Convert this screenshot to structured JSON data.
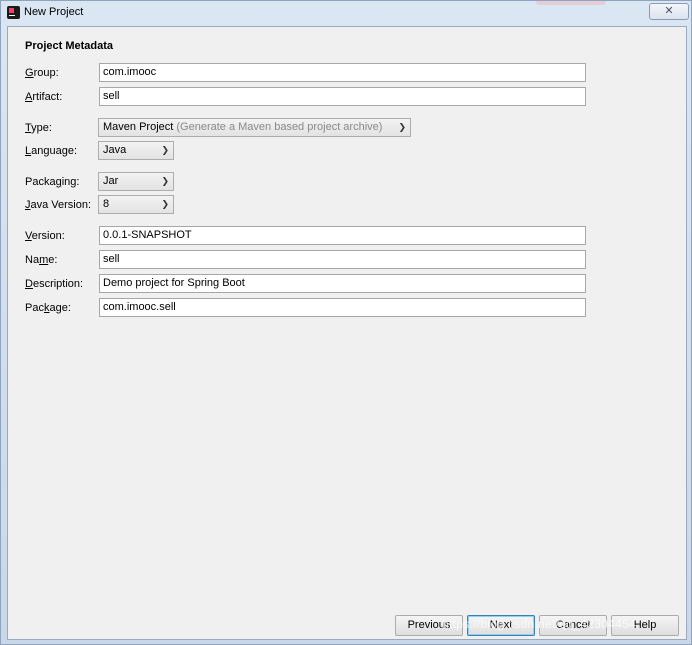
{
  "window": {
    "title": "New Project",
    "close_symbol": "✕"
  },
  "section": {
    "title": "Project Metadata"
  },
  "fields": {
    "group": {
      "label_mnemonic": "G",
      "label_rest": "roup:",
      "value": "com.imooc"
    },
    "artifact": {
      "label_mnemonic": "A",
      "label_rest": "rtifact:",
      "value": "sell"
    },
    "type": {
      "label_mnemonic": "T",
      "label_rest": "ype:",
      "value": "Maven Project",
      "hint": "(Generate a Maven based project archive)"
    },
    "language": {
      "label_mnemonic": "L",
      "label_rest": "anguage:",
      "value": "Java"
    },
    "packaging": {
      "label_pre": "Packa",
      "label_mnemonic": "g",
      "label_rest": "ing:",
      "value": "Jar"
    },
    "java_version": {
      "label_mnemonic": "J",
      "label_rest": "ava Version:",
      "value": "8"
    },
    "version": {
      "label_mnemonic": "V",
      "label_rest": "ersion:",
      "value": "0.0.1-SNAPSHOT"
    },
    "name": {
      "label_pre": "Na",
      "label_mnemonic": "m",
      "label_rest": "e:",
      "value": "sell"
    },
    "description": {
      "label_mnemonic": "D",
      "label_rest": "escription:",
      "value": "Demo project for Spring Boot"
    },
    "package": {
      "label_pre": "Pac",
      "label_mnemonic": "k",
      "label_rest": "age:",
      "value": "com.imooc.sell"
    }
  },
  "buttons": {
    "previous": "Previous",
    "next": "Next",
    "cancel": "Cancel",
    "help": "Help"
  },
  "watermark": "https://blog.csdn.net/qq_42304454",
  "icons": {
    "app": "intellij-idea-icon",
    "dropdown": "chevron-down-icon"
  }
}
